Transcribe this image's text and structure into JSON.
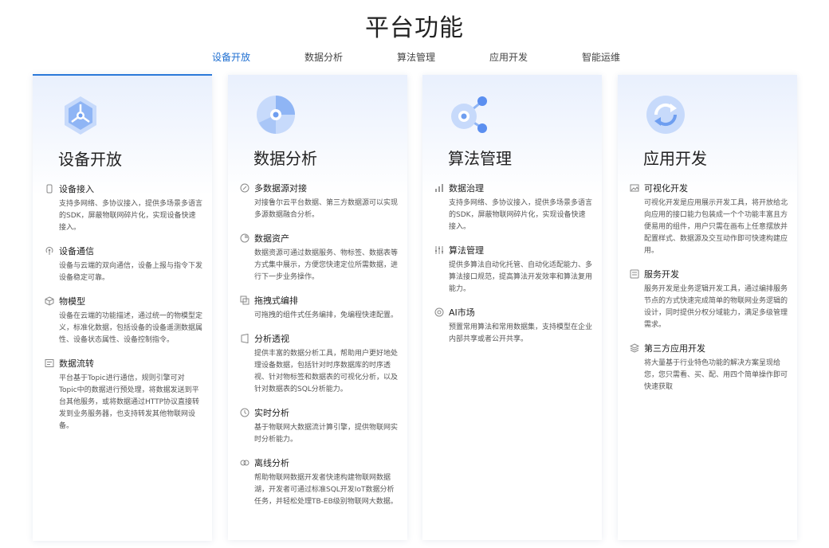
{
  "page_title": "平台功能",
  "tabs": [
    {
      "label": "设备开放",
      "active": true
    },
    {
      "label": "数据分析",
      "active": false
    },
    {
      "label": "算法管理",
      "active": false
    },
    {
      "label": "应用开发",
      "active": false
    },
    {
      "label": "智能运维",
      "active": false
    }
  ],
  "accent_color": "#1f6fd1",
  "cards": [
    {
      "title": "设备开放",
      "icon": "hexagon-node-icon",
      "items": [
        {
          "icon": "device-icon",
          "title": "设备接入",
          "desc": "支持多网络、多协议接入，提供多场景多语言的SDK，屏蔽物联网碎片化，实现设备快速接入。"
        },
        {
          "icon": "signal-icon",
          "title": "设备通信",
          "desc": "设备与云端的双向通信，设备上报与指令下发设备稳定可靠。"
        },
        {
          "icon": "cube-icon",
          "title": "物模型",
          "desc": "设备在云端的功能描述，通过统一的物模型定义，标准化数据，包括设备的设备遥测数据属性、设备状态属性、设备控制指令。"
        },
        {
          "icon": "stream-icon",
          "title": "数据流转",
          "desc": "平台基于Topic进行通信，规则引擎可对Topic中的数据进行预处理，将数据发送到平台其他服务，或将数据通过HTTP协议直接转发到业务服务器，也支持转发其他物联网设备。"
        }
      ]
    },
    {
      "title": "数据分析",
      "icon": "pie-chart-icon",
      "items": [
        {
          "icon": "compass-icon",
          "title": "多数据源对接",
          "desc": "对接鲁尔云平台数据、第三方数据源可以实现多源数据融合分析。"
        },
        {
          "icon": "pie-icon",
          "title": "数据资产",
          "desc": "数据资源可通过数据服务、物标签、数据表等方式集中展示，方便您快速定位所需数据，进行下一步业务操作。"
        },
        {
          "icon": "drag-icon",
          "title": "拖拽式编排",
          "desc": "可拖拽的组件式任务编排，免编程快速配置。"
        },
        {
          "icon": "perspective-icon",
          "title": "分析透视",
          "desc": "提供丰富的数据分析工具，帮助用户更好地处理设备数据，包括针对时序数据库的时序透视、针对物标签和数据表的可视化分析，以及针对数据表的SQL分析能力。"
        },
        {
          "icon": "clock-icon",
          "title": "实时分析",
          "desc": "基于物联网大数据流计算引擎，提供物联网实时分析能力。"
        },
        {
          "icon": "offline-icon",
          "title": "离线分析",
          "desc": "帮助物联网数据开发者快速构建物联网数据湖，开发者可通过标准SQL开发IoT数据分析任务，并轻松处理TB-EB级别物联网大数据。"
        }
      ]
    },
    {
      "title": "算法管理",
      "icon": "share-nodes-icon",
      "items": [
        {
          "icon": "bar-chart-icon",
          "title": "数据治理",
          "desc": "支持多网络、多协议接入，提供多场景多语言的SDK，屏蔽物联网碎片化，实现设备快速接入。"
        },
        {
          "icon": "sliders-icon",
          "title": "算法管理",
          "desc": "提供多算法自动化托管、自动化适配能力、多算法接口规范，提高算法开发效率和算法复用能力。"
        },
        {
          "icon": "ai-icon",
          "title": "AI市场",
          "desc": "预置常用算法和常用数据集，支持模型在企业内部共享或者公开共享。"
        }
      ]
    },
    {
      "title": "应用开发",
      "icon": "refresh-cycle-icon",
      "items": [
        {
          "icon": "image-icon",
          "title": "可视化开发",
          "desc": "可视化开发是应用展示开发工具，将开放给北向应用的接口能力包装成一个个功能丰富且方便易用的组件，用户只需在画布上任意摆放并配置样式、数据源及交互动作即可快速构建应用。"
        },
        {
          "icon": "service-icon",
          "title": "服务开发",
          "desc": "服务开发是业务逻辑开发工具，通过编排服务节点的方式快速完成简单的物联网业务逻辑的设计，同时提供分权分域能力，满足多级管理需求。"
        },
        {
          "icon": "layers-icon",
          "title": "第三方应用开发",
          "desc": "将大量基于行业特色功能的解决方案呈现给您，您只需看、买、配、用四个简单操作即可快速获取"
        }
      ]
    }
  ]
}
